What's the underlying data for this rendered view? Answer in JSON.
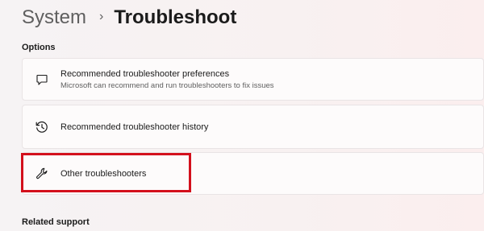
{
  "breadcrumb": {
    "parent": "System",
    "separator": "›",
    "current": "Troubleshoot"
  },
  "options_section": {
    "title": "Options",
    "items": [
      {
        "title": "Recommended troubleshooter preferences",
        "description": "Microsoft can recommend and run troubleshooters to fix issues",
        "icon": "chat-bubble-icon"
      },
      {
        "title": "Recommended troubleshooter history",
        "icon": "history-icon"
      },
      {
        "title": "Other troubleshooters",
        "icon": "wrench-icon",
        "highlighted": true
      }
    ]
  },
  "related_section": {
    "title": "Related support"
  },
  "colors": {
    "highlight": "#d3101c"
  }
}
